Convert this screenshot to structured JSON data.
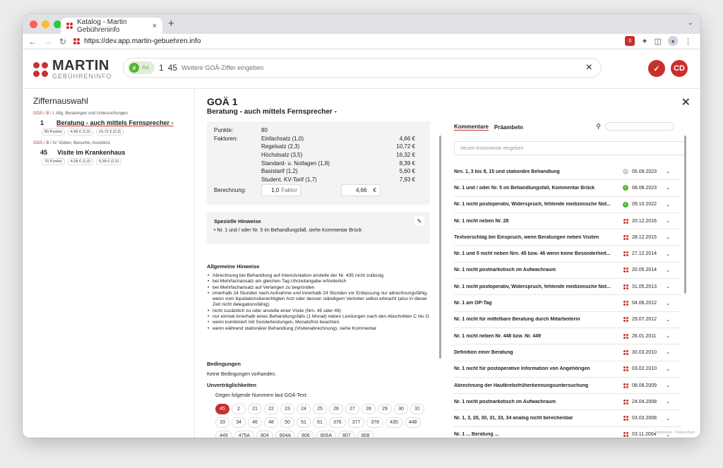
{
  "browser": {
    "tab_title": "Katalog - Martin Gebühreninfo",
    "tab_close": "×",
    "new_tab": "+",
    "url": "https://dev.app.martin-gebuehren.info",
    "ext_badge": "0"
  },
  "brand": {
    "name": "MARTIN",
    "sub": "GEBÜHRENINFO"
  },
  "search": {
    "toggle_hash": "#",
    "toggle_aa": "Aa",
    "chip": "1",
    "chip_value": "45",
    "placeholder": "Weitere GOÄ-Ziffer eingeben",
    "clear": "×"
  },
  "header_actions": {
    "avatar": "CD"
  },
  "left": {
    "title": "Ziffernauswahl",
    "groups": [
      {
        "bc": [
          "GOÄ",
          "B",
          "I. Allg. Beratungen und Untersuchungen"
        ],
        "num": "1",
        "title": "Beratung - auch mittels Fernsprecher -",
        "tags": [
          "80 Punkte",
          "4,66 € (1,0)",
          "10,72 € (2,3)"
        ]
      },
      {
        "bc": [
          "GOÄ",
          "B",
          "IV. Visiten, Besuche, Assistenz"
        ],
        "num": "45",
        "title": "Visite im Krankenhaus",
        "tags": [
          "70 Punkte",
          "4,08 € (1,0)",
          "9,38 € (2,3)"
        ]
      }
    ]
  },
  "detail": {
    "title": "GOÄ 1",
    "subtitle": "Beratung - auch mittels Fernsprecher -",
    "punkte_label": "Punkte:",
    "punkte_value": "80",
    "faktoren_label": "Faktoren:",
    "faktoren": [
      {
        "name": "Einfachsatz (1,0)",
        "value": "4,66 €"
      },
      {
        "name": "Regelsatz (2,3)",
        "value": "10,72 €"
      },
      {
        "name": "Höchstsatz (3,5)",
        "value": "16,32 €"
      },
      {
        "name": "Standard- u. Notlagen (1,8)",
        "value": "8,39 €"
      },
      {
        "name": "Basistarif (1,2)",
        "value": "5,60 €"
      },
      {
        "name": "Student. KV-Tarif (1,7)",
        "value": "7,93 €"
      }
    ],
    "berechnung_label": "Berechnung:",
    "faktor_value": "1,0",
    "faktor_unit": "Faktor",
    "betrag_value": "4,66",
    "betrag_unit": "€",
    "spezielle_title": "Spezielle Hinweise",
    "spezielle_items": [
      "Nr. 1 und / oder Nr. 5 im Behandlungsfall, siehe Kommentar Brück"
    ],
    "allgemeine_title": "Allgemeine Hinweise",
    "allgemeine_items": [
      "Abrechnung bei Behandlung auf Intensivstation anstelle der Nr. 435 nicht zulässig.",
      "bei Mehrfachansatz am gleichen Tag Uhrzeitangabe erforderlich",
      "bei Mehrfachansatz auf Verlangen zu begründen",
      "innerhalb 24 Stunden nach Aufnahme und innerhalb 24 Stunden vor Entlassung nur abrechnungsfähig, wenn vom liquidationsberechtigten Arzt oder dessen ständigem Vertreter selbst erbracht (also in dieser Zeit nicht delegationsfähig).",
      "nicht zusätzlich zu oder anstelle einer Visite (Nrn. 45 oder 46)",
      "nur einmal innerhalb eines Behandlungsfalls (1 Monat) neben Leistungen nach den Abschnitten C bis O",
      "wenn kombiniert mit Sonderleistungen, Monatsfrist beachten.",
      "wenn während stationärer Behandlung (Visitenabrechnung), siehe Kommentar"
    ],
    "bedingungen_title": "Bedingungen",
    "bedingungen_text": "Keine Bedingungen vorhanden.",
    "unvertr_title": "Unverträglichkeiten",
    "unvertr_text": "Gegen folgende Nummern laut GOÄ-Text:",
    "unvertr_nums": [
      "45",
      "2",
      "21",
      "22",
      "23",
      "24",
      "25",
      "26",
      "27",
      "28",
      "29",
      "30",
      "31",
      "33",
      "34",
      "46",
      "48",
      "50",
      "51",
      "61",
      "376",
      "377",
      "378",
      "435",
      "448",
      "449",
      "475A",
      "804",
      "804A",
      "806",
      "806A",
      "807",
      "808"
    ],
    "unvertr_selected": "45"
  },
  "kommentare": {
    "tabs": [
      "Kommentare",
      "Präambeln"
    ],
    "new_placeholder": "Neuen Kommentar eingeben",
    "rows": [
      {
        "title": "Nrn. 1, 3 bis 8, 15 und stationäre Behandlung",
        "status": "grey",
        "date": "05.09.2023"
      },
      {
        "title": "Nr. 1 und / oder Nr. 5 im Behandlungsfall, Kommentar Brück",
        "status": "green",
        "date": "08.08.2023"
      },
      {
        "title": "Nr. 1 nicht postoperativ, Widerspruch, fehlende medizinische Not...",
        "status": "green",
        "date": "09.10.2022"
      },
      {
        "title": "Nr. 1 nicht neben Nr. 28",
        "status": "red",
        "date": "20.12.2016"
      },
      {
        "title": "Textvorschlag bei Einspruch, wenn Beratungen neben Visiten",
        "status": "red",
        "date": "28.12.2015"
      },
      {
        "title": "Nr. 1 und 5 nicht neben Nrn. 45 bzw. 46 wenn keine Besonderheit...",
        "status": "red",
        "date": "27.12.2014"
      },
      {
        "title": "Nr. 1 nicht postnarkotisch im Aufwachraum",
        "status": "red",
        "date": "20.05.2014"
      },
      {
        "title": "Nr. 1 nicht postoperativ, Widerspruch, fehlende medizinische Not...",
        "status": "red",
        "date": "31.05.2013"
      },
      {
        "title": "Nr. 1 am OP-Tag",
        "status": "red",
        "date": "04.08.2012"
      },
      {
        "title": "Nr. 1 nicht für mittelbare Beratung durch Mitarbeiterin",
        "status": "red",
        "date": "29.07.2012"
      },
      {
        "title": "Nr. 1 nicht neben Nr. 448 bzw. Nr. 449",
        "status": "red",
        "date": "26.01.2011"
      },
      {
        "title": "Definition einer Beratung",
        "status": "red",
        "date": "30.03.2010"
      },
      {
        "title": "Nr. 1 nicht für postoperative Information von Angehörigen",
        "status": "red",
        "date": "03.02.2010"
      },
      {
        "title": "Abrechnung der Hautkrebsfrüherkennungsuntersuchung",
        "status": "red",
        "date": "08.08.2009"
      },
      {
        "title": "Nr. 1 nicht postnarkotisch im Aufwachraum",
        "status": "red",
        "date": "24.04.2008"
      },
      {
        "title": "Nr. 1, 3, 20, 30, 31, 33, 34 analog nicht berechenbar",
        "status": "red",
        "date": "03.03.2008"
      },
      {
        "title": "Nr. 1 ... Beratung ...",
        "status": "red",
        "date": "03.11.2004"
      }
    ]
  },
  "footer": {
    "impressum": "Impressum",
    "datenschutz": "Datenschutz"
  },
  "colors": {
    "brand_red": "#c8302e",
    "ok_green": "#58b338"
  }
}
